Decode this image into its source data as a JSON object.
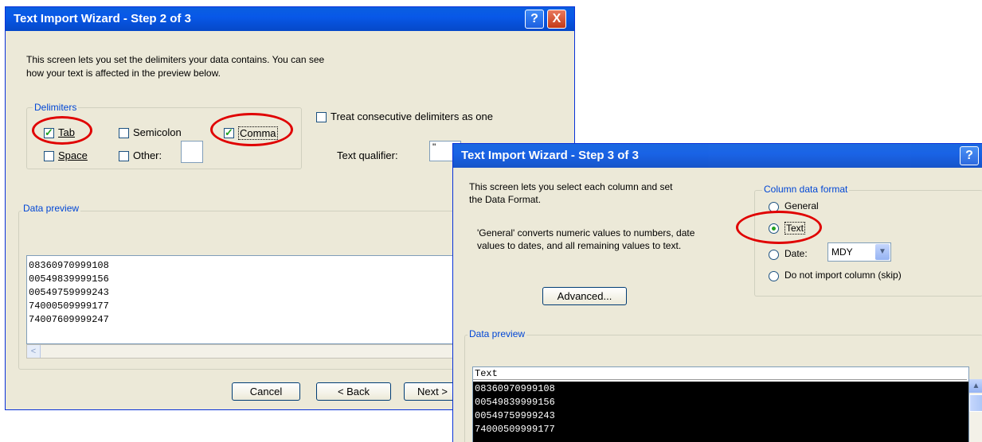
{
  "step2": {
    "title": "Text Import Wizard - Step 2 of 3",
    "help_label": "?",
    "close_label": "X",
    "description_line1": "This screen lets you set the delimiters your data contains.  You can see",
    "description_line2": "how your text is affected in the preview below.",
    "delimiters_legend": "Delimiters",
    "tab_label": "Tab",
    "semicolon_label": "Semicolon",
    "comma_label": "Comma",
    "space_label": "Space",
    "other_label": "Other:",
    "treat_consecutive_label": "Treat consecutive delimiters as one",
    "text_qualifier_label": "Text qualifier:",
    "text_qualifier_value": "\"",
    "data_preview_legend": "Data preview",
    "preview_rows": [
      "08360970999108",
      "00549839999156",
      "00549759999243",
      "74000509999177",
      "74007609999247"
    ],
    "cancel_label": "Cancel",
    "back_label": "< Back",
    "next_label": "Next >",
    "checks": {
      "tab": true,
      "semicolon": false,
      "comma": true,
      "space": false,
      "other": false,
      "consecutive": false
    }
  },
  "step3": {
    "title": "Text Import Wizard - Step 3 of 3",
    "help_label": "?",
    "description_line1": "This screen lets you select each column and set",
    "description_line2": "the Data Format.",
    "general_note_line1": "'General' converts numeric values to numbers, date",
    "general_note_line2": "values to dates, and all remaining values to text.",
    "advanced_label": "Advanced...",
    "column_format_legend": "Column data format",
    "general_label": "General",
    "text_label": "Text",
    "date_label": "Date:",
    "date_value": "MDY",
    "skip_label": "Do not import column (skip)",
    "selected_format": "Text",
    "data_preview_legend": "Data preview",
    "preview_header": "Text",
    "preview_rows": [
      "08360970999108",
      "00549839999156",
      "00549759999243",
      "74000509999177"
    ]
  },
  "colors": {
    "titlebar": "#0858e8",
    "highlight_circle": "#e00000",
    "dialog_bg": "#ece9d8",
    "preview_selected_bg": "#000000"
  }
}
